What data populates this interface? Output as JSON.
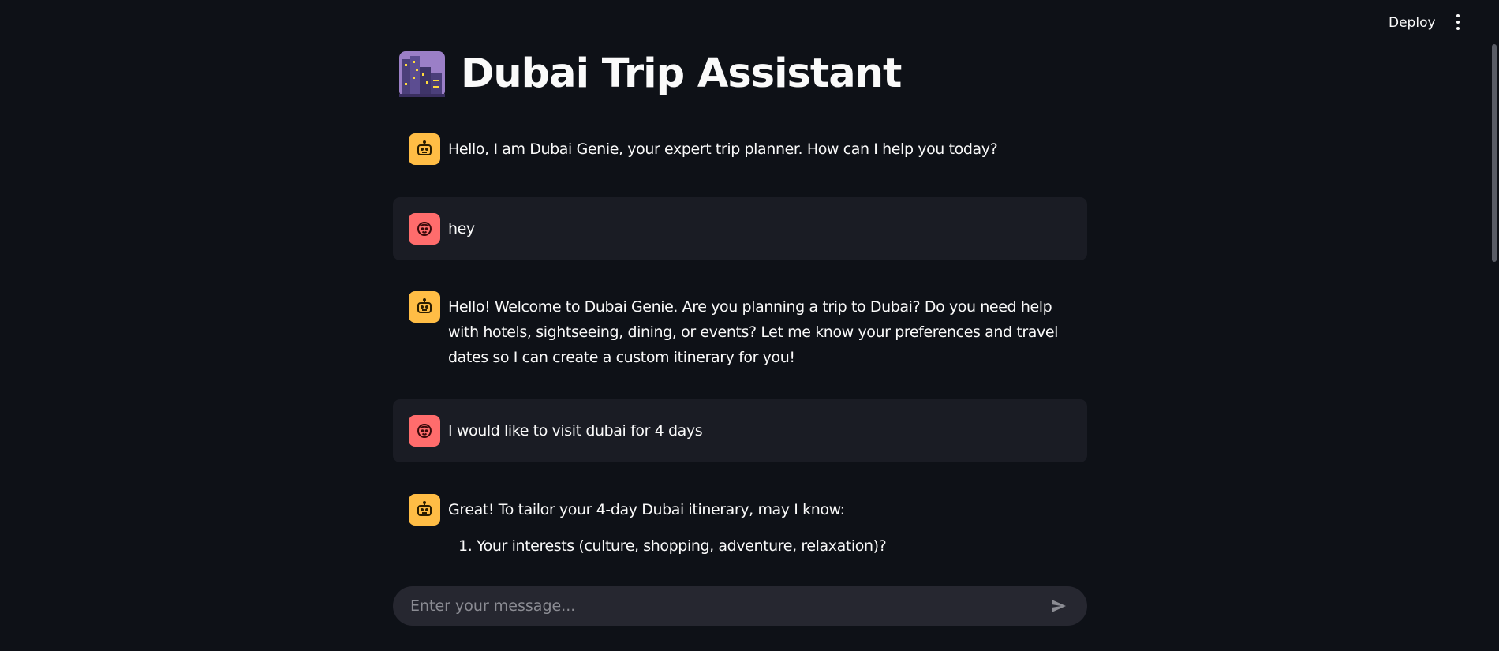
{
  "header": {
    "deploy_label": "Deploy",
    "menu_icon": "kebab-menu-icon"
  },
  "page": {
    "title": "Dubai Trip Assistant",
    "title_icon": "cityscape-at-dusk-emoji"
  },
  "messages": [
    {
      "role": "assistant",
      "avatar_icon": "robot-face-icon",
      "text": "Hello, I am Dubai Genie, your expert trip planner. How can I help you today?"
    },
    {
      "role": "user",
      "avatar_icon": "smiling-face-icon",
      "text": "hey"
    },
    {
      "role": "assistant",
      "avatar_icon": "robot-face-icon",
      "text": "Hello! Welcome to Dubai Genie. Are you planning a trip to Dubai? Do you need help with hotels, sightseeing, dining, or events? Let me know your preferences and travel dates so I can create a custom itinerary for you!"
    },
    {
      "role": "user",
      "avatar_icon": "smiling-face-icon",
      "text": "I would like to visit dubai for 4 days"
    },
    {
      "role": "assistant",
      "avatar_icon": "robot-face-icon",
      "text": "Great! To tailor your 4-day Dubai itinerary, may I know:",
      "list": [
        "Your interests (culture, shopping, adventure, relaxation)?"
      ]
    }
  ],
  "chat_input": {
    "placeholder": "Enter your message...",
    "value": "",
    "send_icon": "send-arrow-icon"
  },
  "colors": {
    "background": "#0e1117",
    "assistant_avatar": "#ffbd45",
    "user_avatar": "#ff6c6c",
    "user_bubble": "#1a1c24",
    "input_bg": "#262730"
  }
}
